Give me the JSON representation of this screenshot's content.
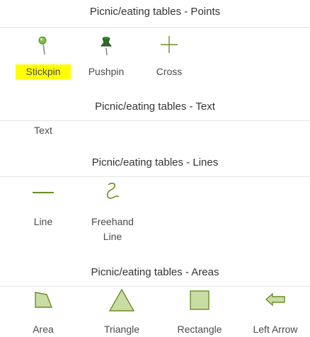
{
  "sections": [
    {
      "header": "Picnic/eating tables - Points",
      "items": [
        {
          "label": "Stickpin",
          "icon": "stickpin-icon",
          "selected": true
        },
        {
          "label": "Pushpin",
          "icon": "pushpin-icon"
        },
        {
          "label": "Cross",
          "icon": "cross-icon"
        }
      ]
    },
    {
      "header": "Picnic/eating tables - Text",
      "items": [
        {
          "label": "Text",
          "icon": "text-icon"
        }
      ]
    },
    {
      "header": "Picnic/eating tables - Lines",
      "items": [
        {
          "label": "Line",
          "icon": "line-icon"
        },
        {
          "label": "Freehand Line",
          "icon": "freehand-line-icon"
        }
      ]
    },
    {
      "header": "Picnic/eating tables - Areas",
      "items": [
        {
          "label": "Area",
          "icon": "area-icon"
        },
        {
          "label": "Triangle",
          "icon": "triangle-icon"
        },
        {
          "label": "Rectangle",
          "icon": "rectangle-icon"
        },
        {
          "label": "Left Arrow",
          "icon": "left-arrow-icon"
        }
      ]
    }
  ],
  "colors": {
    "symbol_fill": "#c9dca3",
    "symbol_stroke": "#6b8e23",
    "selected_highlight": "#ffff00",
    "divider": "#e6e6e6"
  }
}
